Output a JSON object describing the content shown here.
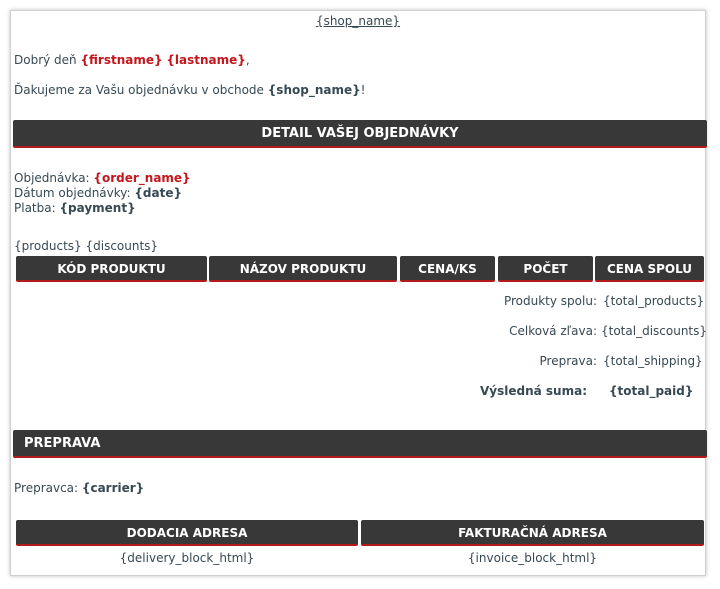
{
  "header": {
    "shop_link": "{shop_name}"
  },
  "greeting": {
    "prefix": "Dobrý deň",
    "firstname": "{firstname}",
    "lastname": "{lastname}",
    "suffix": ","
  },
  "thanks": {
    "prefix": "Ďakujeme za Vašu objednávku v obchode",
    "shop": "{shop_name}",
    "suffix": "!"
  },
  "detail_bar": "DETAIL VAŠEJ OBJEDNÁVKY",
  "order": {
    "order_label": "Objednávka:",
    "order_value": "{order_name}",
    "date_label": "Dátum objednávky:",
    "date_value": "{date}",
    "payment_label": "Platba:",
    "payment_value": "{payment}"
  },
  "placeholders": "{products} {discounts}",
  "table": {
    "headers": [
      "KÓD PRODUKTU",
      "NÁZOV PRODUKTU",
      "CENA/KS",
      "POČET",
      "CENA SPOLU"
    ]
  },
  "totals": [
    {
      "label": "Produkty spolu:",
      "value": "{total_products}",
      "bold": false
    },
    {
      "label": "Celková zľava:",
      "value": "{total_discounts}",
      "bold": false
    },
    {
      "label": "Preprava:",
      "value": "{total_shipping}",
      "bold": false
    },
    {
      "label": "Výsledná suma:",
      "value": "{total_paid}",
      "bold": true
    }
  ],
  "shipping_bar": "PREPRAVA",
  "carrier": {
    "label": "Prepravca:",
    "value": "{carrier}"
  },
  "addresses": {
    "delivery_header": "DODACIA ADRESA",
    "invoice_header": "FAKTURAČNÁ ADRESA",
    "delivery_value": "{delivery_block_html}",
    "invoice_value": "{invoice_block_html}"
  },
  "colors": {
    "bar_bg": "#383838",
    "bar_border": "#b31a1a",
    "highlight_red": "#c4161c",
    "text": "#374953"
  }
}
